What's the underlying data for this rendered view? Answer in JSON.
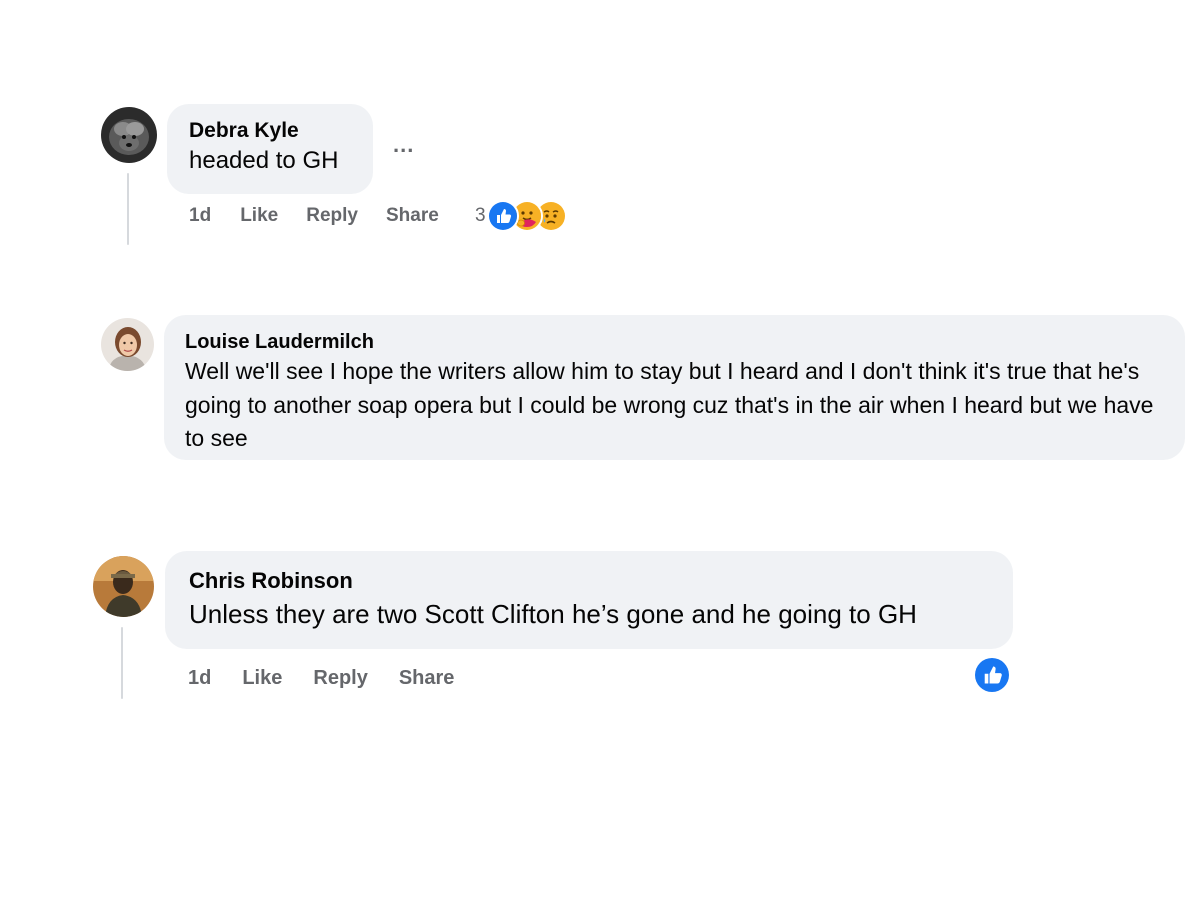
{
  "comments": [
    {
      "author": "Debra Kyle",
      "text": "headed to GH",
      "more_label": "...",
      "actions": {
        "time": "1d",
        "like": "Like",
        "reply": "Reply",
        "share": "Share"
      },
      "reaction_count": "3",
      "reactions": [
        "like-icon",
        "hug-icon",
        "sad-icon"
      ]
    },
    {
      "author": "Louise Laudermilch",
      "text": "Well we'll see I hope the writers allow him to stay but I heard and I don't think it's true that he's going to another soap opera but I could be wrong cuz that's in the air when I heard but we have to see"
    },
    {
      "author": "Chris Robinson",
      "text": "Unless they are two Scott Clifton he’s gone and he going to GH",
      "actions": {
        "time": "1d",
        "like": "Like",
        "reply": "Reply",
        "share": "Share"
      },
      "reactions": [
        "like-icon"
      ]
    }
  ],
  "colors": {
    "bubble": "#f0f2f5",
    "meta_text": "#65676b",
    "like_blue": "#1877f2",
    "thread_line": "#d6d9dd"
  }
}
